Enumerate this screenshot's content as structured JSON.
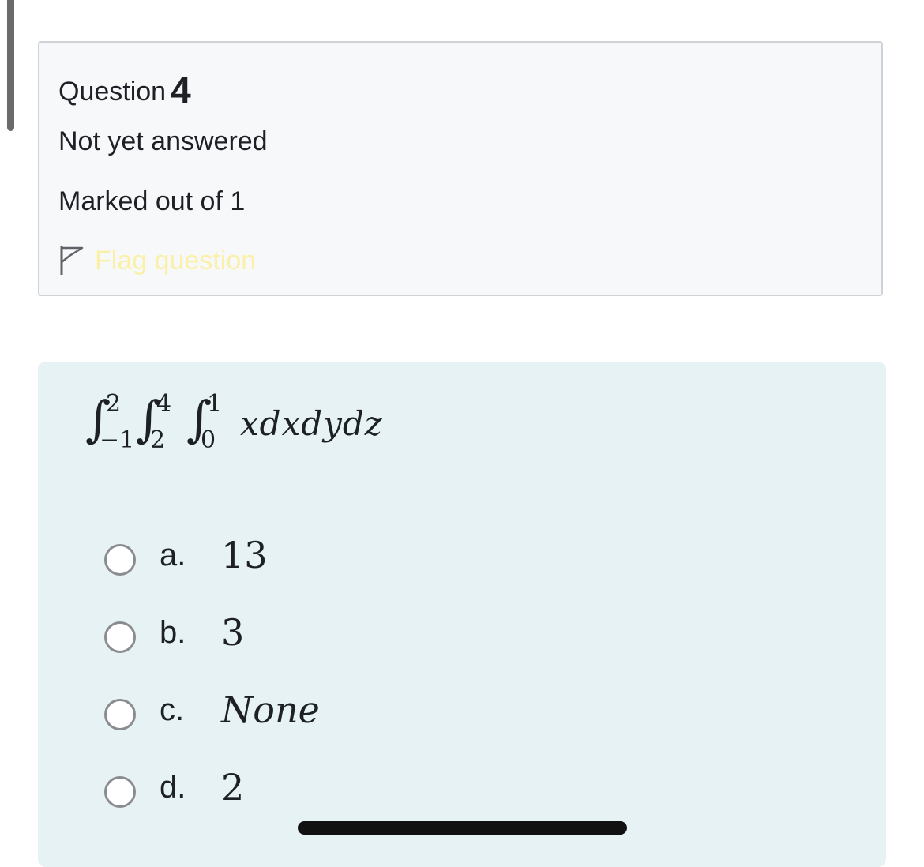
{
  "info": {
    "question_label": "Question",
    "question_number": "4",
    "status": "Not yet answered",
    "marked_out_of": "Marked out of 1",
    "flag_label": "Flag question"
  },
  "question": {
    "integrals": [
      {
        "upper": "2",
        "lower": "−1"
      },
      {
        "upper": "4",
        "lower": "2"
      },
      {
        "upper": "1",
        "lower": "0"
      }
    ],
    "integrand": "xdxdydz"
  },
  "options": [
    {
      "letter": "a.",
      "value": "13"
    },
    {
      "letter": "b.",
      "value": "3"
    },
    {
      "letter": "c.",
      "value": "None"
    },
    {
      "letter": "d.",
      "value": "2"
    }
  ],
  "colors": {
    "flag_text": "#fbf0a8",
    "question_panel_bg": "#e7f2f5",
    "info_card_bg": "#f7f8fa"
  }
}
